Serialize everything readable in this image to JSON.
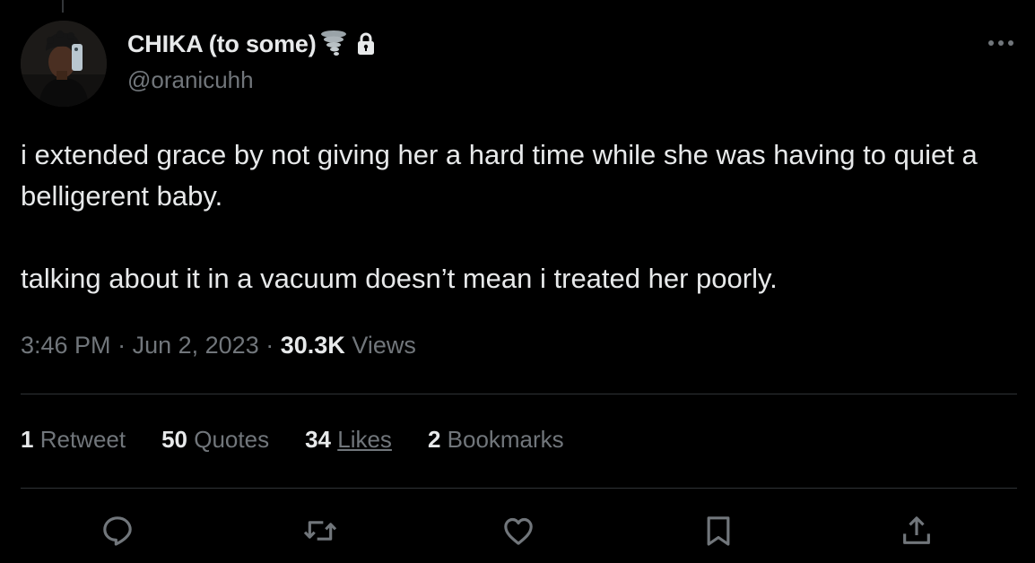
{
  "author": {
    "display_name": "CHIKA (to some)",
    "handle": "@oranicuhh",
    "name_emoji": "tornado-icon",
    "protected_icon": "lock-icon"
  },
  "tweet": {
    "paragraphs": [
      "i extended grace by not giving her a hard time while she was having to quiet a belligerent baby.",
      "talking about it in a vacuum doesn’t mean i treated her poorly."
    ]
  },
  "meta": {
    "time": "3:46 PM",
    "separator": "·",
    "date": "Jun 2, 2023",
    "views_count": "30.3K",
    "views_label": "Views"
  },
  "stats": {
    "retweets": {
      "count": "1",
      "label": "Retweet"
    },
    "quotes": {
      "count": "50",
      "label": "Quotes"
    },
    "likes": {
      "count": "34",
      "label": "Likes"
    },
    "bookmarks": {
      "count": "2",
      "label": "Bookmarks"
    }
  },
  "actions": [
    "reply-icon",
    "retweet-icon",
    "like-icon",
    "bookmark-icon",
    "share-icon"
  ],
  "colors": {
    "background": "#000000",
    "primary_text": "#e7e9ea",
    "secondary_text": "#71767b",
    "divider": "#2f3336"
  }
}
